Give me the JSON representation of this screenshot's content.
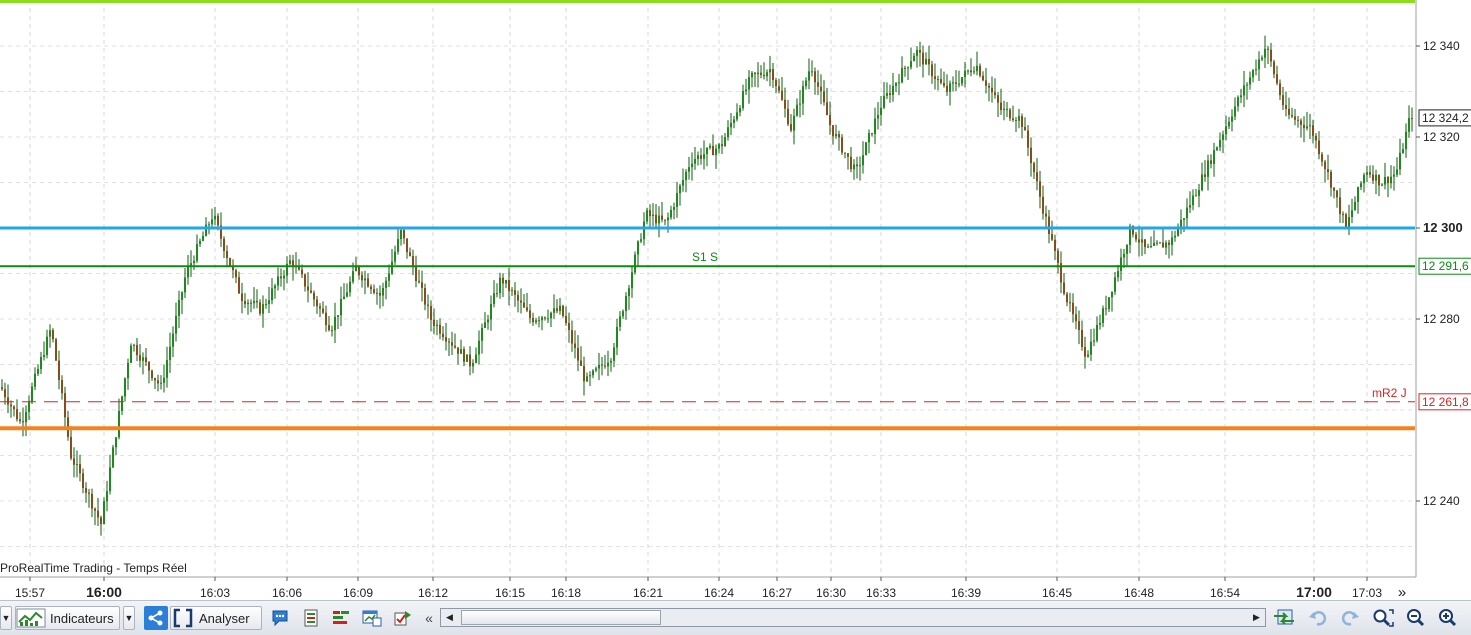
{
  "chart_data": {
    "type": "candlestick",
    "title": "ProRealTime Trading - Temps Réel",
    "y_range": [
      12220,
      12350
    ],
    "y_tick_labels": [
      "12 340",
      "12 320",
      "12 300",
      "12 280",
      "12 240"
    ],
    "y_tick_values": [
      12340,
      12320,
      12300,
      12280,
      12240
    ],
    "x_tick_labels": [
      "15:57",
      "16:00",
      "16:03",
      "16:06",
      "16:09",
      "16:12",
      "16:15",
      "16:18",
      "16:21",
      "16:24",
      "16:27",
      "16:30",
      "16:33",
      "16:39",
      "16:45",
      "16:48",
      "16:54",
      "17:00",
      "17:03"
    ],
    "x_bold_ticks": [
      "16:00",
      "17:00"
    ],
    "price_path": [
      [
        0,
        12265
      ],
      [
        20,
        12257
      ],
      [
        50,
        12278
      ],
      [
        70,
        12250
      ],
      [
        100,
        12235
      ],
      [
        130,
        12275
      ],
      [
        160,
        12265
      ],
      [
        185,
        12290
      ],
      [
        212,
        12303
      ],
      [
        240,
        12285
      ],
      [
        260,
        12282
      ],
      [
        290,
        12293
      ],
      [
        330,
        12278
      ],
      [
        355,
        12291
      ],
      [
        380,
        12285
      ],
      [
        400,
        12299
      ],
      [
        430,
        12280
      ],
      [
        470,
        12270
      ],
      [
        500,
        12289
      ],
      [
        530,
        12280
      ],
      [
        560,
        12282
      ],
      [
        585,
        12266
      ],
      [
        610,
        12272
      ],
      [
        645,
        12303
      ],
      [
        665,
        12301
      ],
      [
        690,
        12315
      ],
      [
        720,
        12318
      ],
      [
        750,
        12333
      ],
      [
        770,
        12335
      ],
      [
        790,
        12322
      ],
      [
        810,
        12336
      ],
      [
        830,
        12322
      ],
      [
        855,
        12312
      ],
      [
        880,
        12327
      ],
      [
        915,
        12339
      ],
      [
        945,
        12330
      ],
      [
        975,
        12336
      ],
      [
        1000,
        12326
      ],
      [
        1020,
        12324
      ],
      [
        1040,
        12306
      ],
      [
        1065,
        12285
      ],
      [
        1085,
        12272
      ],
      [
        1105,
        12283
      ],
      [
        1130,
        12300
      ],
      [
        1145,
        12295
      ],
      [
        1170,
        12297
      ],
      [
        1195,
        12308
      ],
      [
        1230,
        12325
      ],
      [
        1265,
        12340
      ],
      [
        1285,
        12325
      ],
      [
        1310,
        12322
      ],
      [
        1330,
        12310
      ],
      [
        1345,
        12300
      ],
      [
        1365,
        12313
      ],
      [
        1380,
        12310
      ],
      [
        1395,
        12312
      ],
      [
        1410,
        12325
      ]
    ],
    "horizontal_lines": [
      {
        "value": 12350,
        "color": "#8cdc1e",
        "style": "solid",
        "width": 3
      },
      {
        "value": 12300,
        "color": "#1ea6ee",
        "style": "solid",
        "width": 3
      },
      {
        "value": 12291.6,
        "color": "#0c8a12",
        "style": "solid",
        "width": 2,
        "label": "S1 S",
        "price_tag": "12 291,6"
      },
      {
        "value": 12261.8,
        "color": "#e02020",
        "style": "dashed",
        "width": 1,
        "label": "mR2 J",
        "price_tag": "12 261,8"
      },
      {
        "value": 12256,
        "color": "#f58220",
        "style": "solid",
        "width": 4
      }
    ],
    "current_price_tag": "12 324,2",
    "grid": true,
    "colors": {
      "up": "#1d8a1d",
      "down": "#8b4a1a",
      "wick": "#0d5f0d"
    }
  },
  "toolbar": {
    "indicators_label": "Indicateurs",
    "analyze_label": "Analyser"
  }
}
